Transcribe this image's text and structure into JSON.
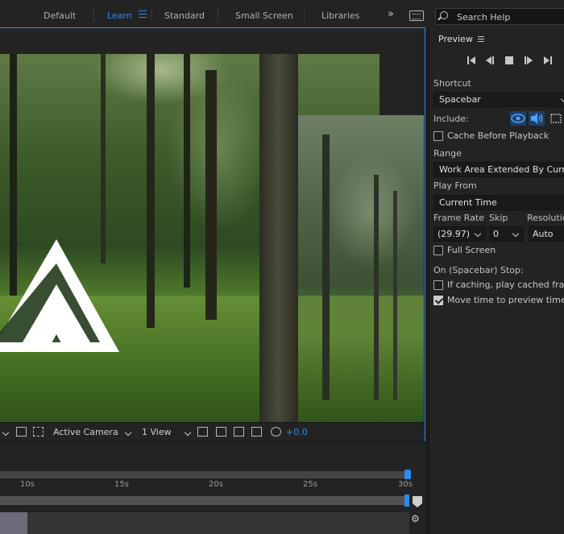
{
  "workspace": {
    "tabs": [
      {
        "label": "Default",
        "active": false
      },
      {
        "label": "Learn",
        "active": true
      },
      {
        "label": "Standard",
        "active": false
      },
      {
        "label": "Small Screen",
        "active": false
      },
      {
        "label": "Libraries",
        "active": false
      }
    ],
    "overflow_icon": "double-chevron-right-icon",
    "search": {
      "placeholder": "Search Help"
    }
  },
  "viewer": {
    "toolbar": {
      "camera": "Active Camera",
      "views": "1 View",
      "exposure": "+0.0"
    }
  },
  "timeline": {
    "ticks": [
      "10s",
      "15s",
      "20s",
      "25s",
      "30s"
    ]
  },
  "preview": {
    "title": "Preview",
    "shortcut_label": "Shortcut",
    "shortcut_value": "Spacebar",
    "include_label": "Include:",
    "cache_before_playback": {
      "label": "Cache Before Playback",
      "checked": false
    },
    "range_label": "Range",
    "range_value": "Work Area Extended By Current",
    "play_from_label": "Play From",
    "play_from_value": "Current Time",
    "frame_rate_label": "Frame Rate",
    "skip_label": "Skip",
    "resolution_label": "Resolution",
    "frame_rate_value": "(29.97)",
    "skip_value": "0",
    "resolution_value": "Auto",
    "full_screen": {
      "label": "Full Screen",
      "checked": false
    },
    "on_stop_label": "On (Spacebar) Stop:",
    "if_caching": {
      "label": "If caching, play cached frames",
      "checked": false
    },
    "move_time": {
      "label": "Move time to preview time",
      "checked": true
    }
  },
  "colors": {
    "accent": "#2d8ceb",
    "panel": "#232323",
    "background": "#1d1d1d"
  }
}
